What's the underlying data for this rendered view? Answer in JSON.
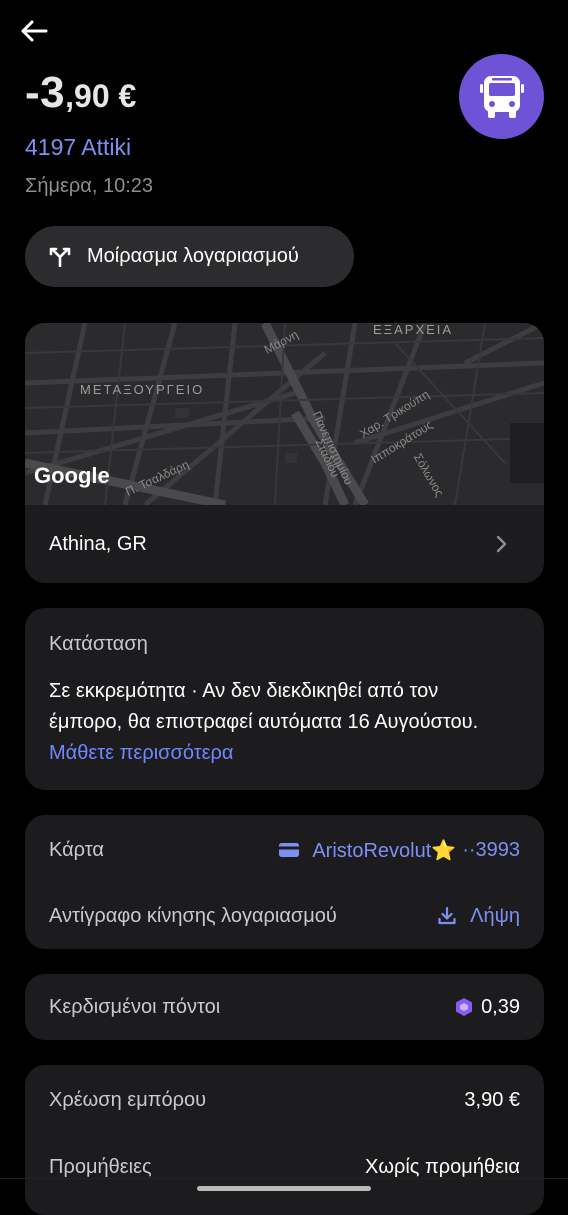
{
  "header": {
    "back_icon": "arrow-left-icon",
    "amount_main": "-3",
    "amount_decimal": ",90 €",
    "merchant_icon": "bus-icon",
    "merchant_icon_color": "#6f53d7",
    "merchant_name": "4197 Attiki",
    "date": "Σήμερα, 10:23"
  },
  "split_button": {
    "icon": "split-icon",
    "label": "Μοίρασμα λογαριασμού"
  },
  "map": {
    "labels": [
      "ΕΞΑΡΧΕΙΑ",
      "ΜΕΤΑΞΟΥΡΓΕΙΟ"
    ],
    "streets": [
      "Μάρνη",
      "Πανεπιστημίου",
      "Σταδίου",
      "Χαρ. Τρικούπη",
      "Ιπποκράτους",
      "Σόλωνος",
      "Π. Τσαλδάρη"
    ],
    "provider": "Google",
    "location": "Athina, GR"
  },
  "status": {
    "title": "Κατάσταση",
    "body": "Σε εκκρεμότητα · Αν δεν διεκδικηθεί από τον έμπορο, θα επιστραφεί αυτόματα 16 Αυγούστου.",
    "link": "Μάθετε περισσότερα"
  },
  "card_section": {
    "card_label": "Κάρτα",
    "card_name": "AristoRevolut⭐",
    "card_last4": "··3993",
    "statement_label": "Αντίγραφο κίνησης λογαριασμού",
    "statement_action": "Λήψη"
  },
  "points": {
    "label": "Κερδισμένοι πόντοι",
    "value": "0,39",
    "icon": "points-hexagon-icon"
  },
  "charges": {
    "merchant_label": "Χρέωση εμπόρου",
    "merchant_value": "3,90 €",
    "fees_label": "Προμήθειες",
    "fees_value": "Χωρίς προμήθεια"
  },
  "colors": {
    "accent": "#7d8ff3",
    "card_bg": "#1c1c1e",
    "background": "#000000"
  }
}
